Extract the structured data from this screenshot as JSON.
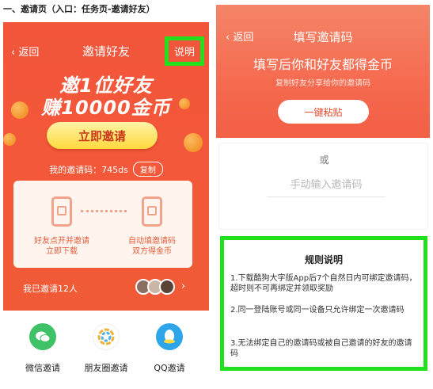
{
  "heading": "一、邀请页（入口：任务页-邀请好友）",
  "left": {
    "back_label": "返回",
    "title": "邀请好友",
    "explain_label": "说明",
    "slogan_line1": "邀1位好友",
    "slogan_line2": "赚10000金币",
    "invite_button": "立即邀请",
    "my_code_label": "我的邀请码：745ds",
    "copy_button": "复制",
    "steps": [
      {
        "line1": "好友点开并邀请",
        "line2": "立即下载"
      },
      {
        "line1": "自动填邀请码",
        "line2": "双方得金币"
      }
    ],
    "invited_label": "我已邀请12人",
    "share": [
      {
        "label": "微信邀请",
        "icon": "wechat-icon",
        "color": "#3ec167"
      },
      {
        "label": "朋友圈邀请",
        "icon": "moments-icon",
        "color": "#ffffff"
      },
      {
        "label": "QQ邀请",
        "icon": "qq-icon",
        "color": "#2ea5e8"
      }
    ]
  },
  "right": {
    "back_label": "返回",
    "title": "填写邀请码",
    "headline": "填写后你和好友都得金币",
    "subline": "复制好友分享给你的邀请码",
    "paste_button": "一键粘贴",
    "or_label": "或",
    "input_placeholder": "手动输入邀请码",
    "rules_title": "规则说明",
    "rules": [
      "1.下载酷狗大字版App后7个自然日内可绑定邀请码，超时则不可再绑定并领取奖励",
      "2.同一登陆账号或同一设备只允许绑定一次邀请码",
      "3.无法绑定自己的邀请码或被自己邀请的好友的邀请码"
    ]
  },
  "colors": {
    "accent_red": "#f2553a",
    "highlight_green": "#22e01e",
    "gold": "#ffd93d"
  }
}
